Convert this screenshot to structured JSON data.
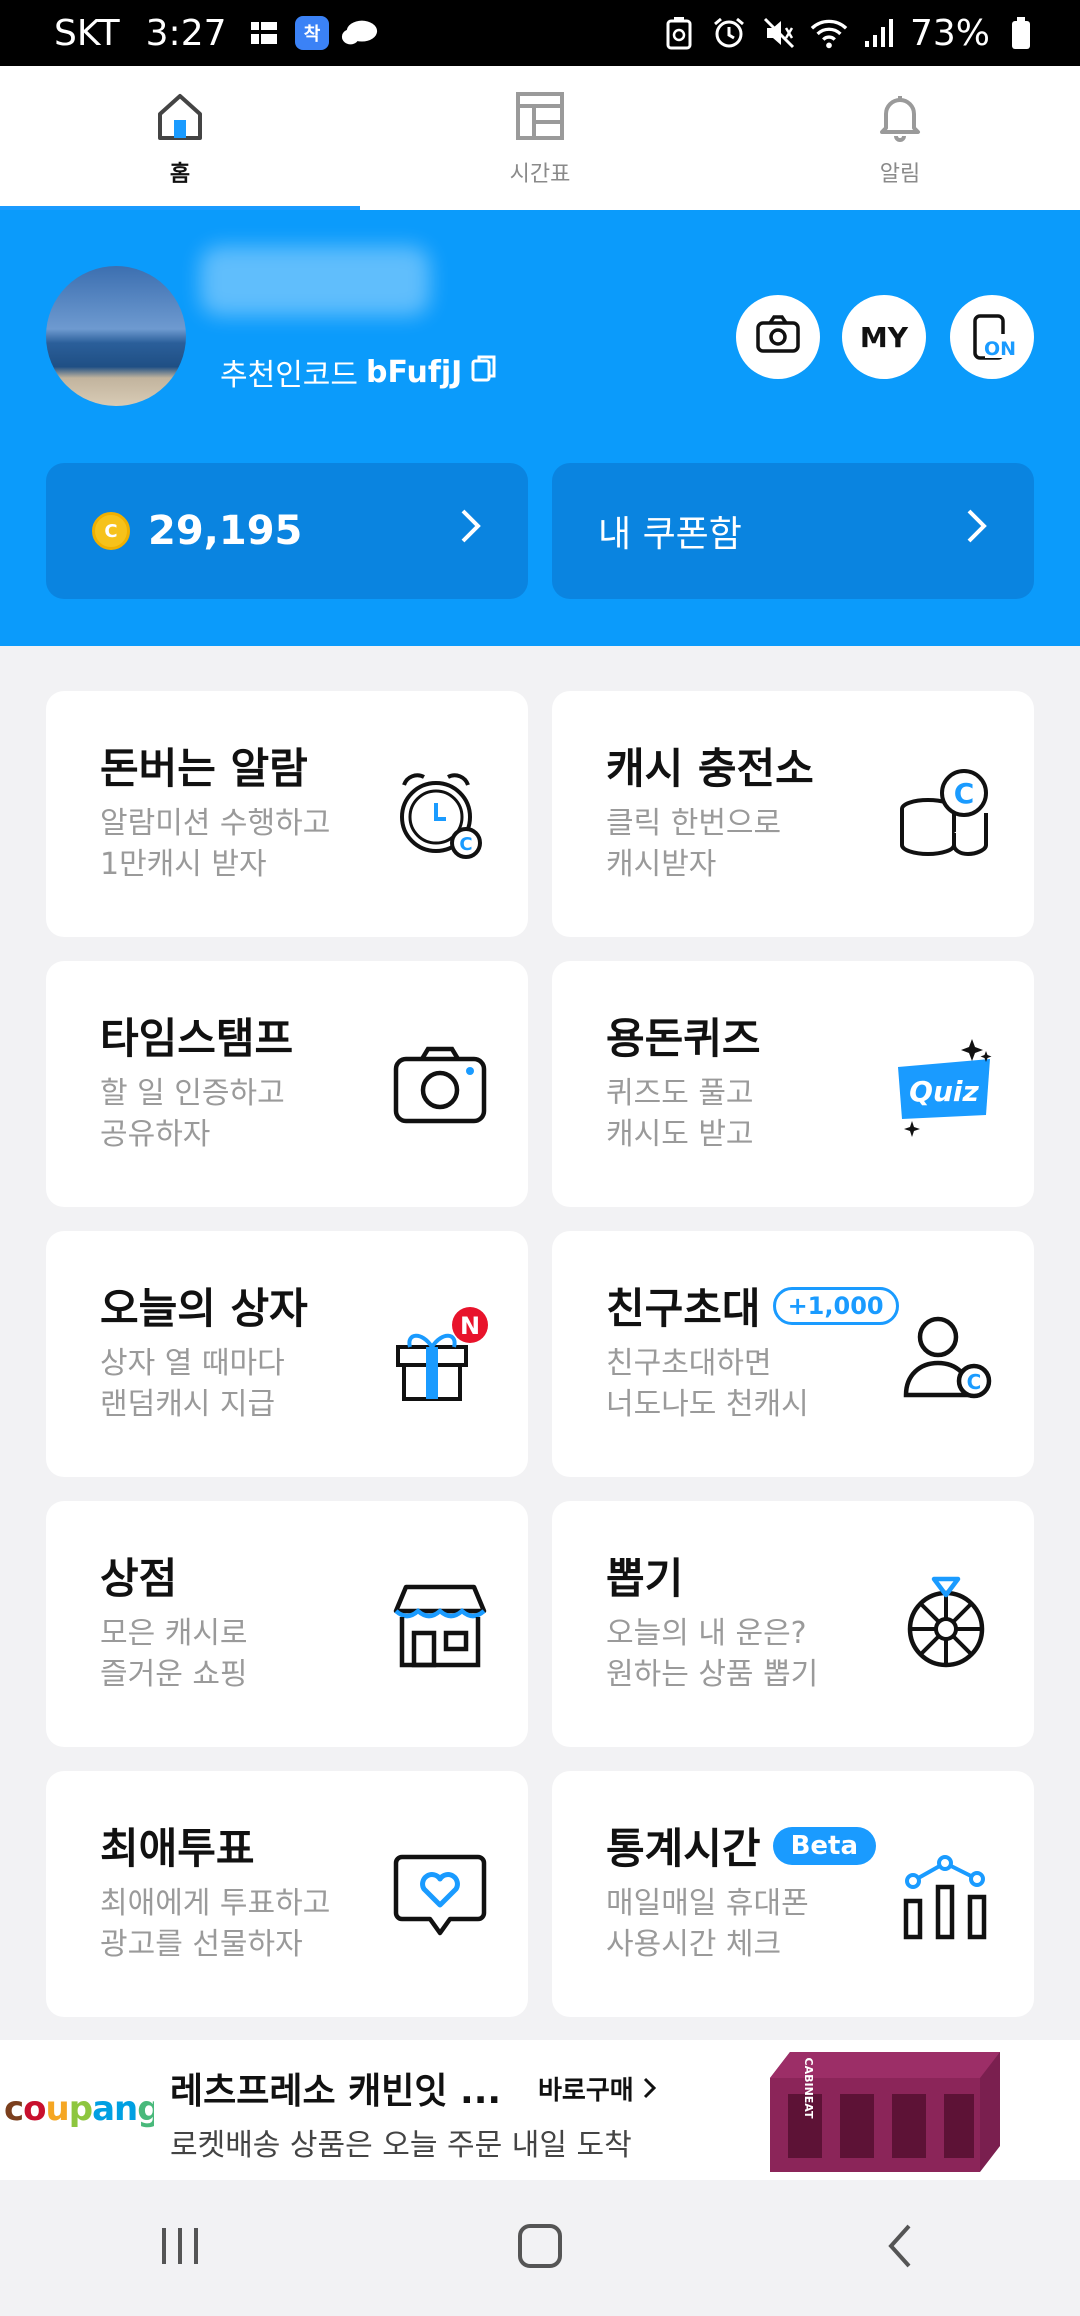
{
  "status_bar": {
    "carrier": "SKT",
    "time": "3:27",
    "battery": "73%"
  },
  "tabs": [
    {
      "label": "홈",
      "icon": "home-icon",
      "active": true
    },
    {
      "label": "시간표",
      "icon": "timetable-icon",
      "active": false
    },
    {
      "label": "알림",
      "icon": "bell-icon",
      "active": false
    }
  ],
  "profile": {
    "referral_label": "추천인코드",
    "referral_code": "bFufjJ",
    "buttons": {
      "camera": "camera-icon",
      "my": "MY",
      "on": "ON"
    },
    "cash": "29,195",
    "coupon": "내 쿠폰함"
  },
  "cards": [
    {
      "title": "돈버는 알람",
      "desc1": "알람미션 수행하고",
      "desc2": "1만캐시 받자",
      "icon": "alarm-clock-icon"
    },
    {
      "title": "캐시 충전소",
      "desc1": "클릭 한번으로",
      "desc2": "캐시받자",
      "icon": "coins-icon"
    },
    {
      "title": "타임스탬프",
      "desc1": "할 일 인증하고",
      "desc2": "공유하자",
      "icon": "camera-icon"
    },
    {
      "title": "용돈퀴즈",
      "desc1": "퀴즈도 풀고",
      "desc2": "캐시도 받고",
      "icon": "quiz-icon",
      "icon_text": "Quiz"
    },
    {
      "title": "오늘의 상자",
      "desc1": "상자 열 때마다",
      "desc2": "랜덤캐시 지급",
      "icon": "gift-box-icon",
      "icon_badge": "N"
    },
    {
      "title": "친구초대",
      "desc1": "친구초대하면",
      "desc2": "너도나도 천캐시",
      "icon": "friend-icon",
      "badge": "+1,000"
    },
    {
      "title": "상점",
      "desc1": "모은 캐시로",
      "desc2": "즐거운 쇼핑",
      "icon": "store-icon"
    },
    {
      "title": "뽑기",
      "desc1": "오늘의 내 운은?",
      "desc2": "원하는 상품 뽑기",
      "icon": "roulette-icon"
    },
    {
      "title": "최애투표",
      "desc1": "최애에게 투표하고",
      "desc2": "광고를 선물하자",
      "icon": "heart-chat-icon"
    },
    {
      "title": "통계시간",
      "desc1": "매일매일 휴대폰",
      "desc2": "사용시간 체크",
      "icon": "stats-icon",
      "badge": "Beta"
    }
  ],
  "ad": {
    "logo": "coupang",
    "title": "레츠프레소 캐빈잇 ...",
    "buy": "바로구매",
    "subtitle": "로켓배송 상품은 오늘 주문 내일 도착",
    "product_text": "CABINEAT"
  },
  "colors": {
    "brand": "#0b9bfb",
    "brand_dark": "#0a84e0",
    "accent": "#1a9bff",
    "badge_red": "#e8132b"
  }
}
